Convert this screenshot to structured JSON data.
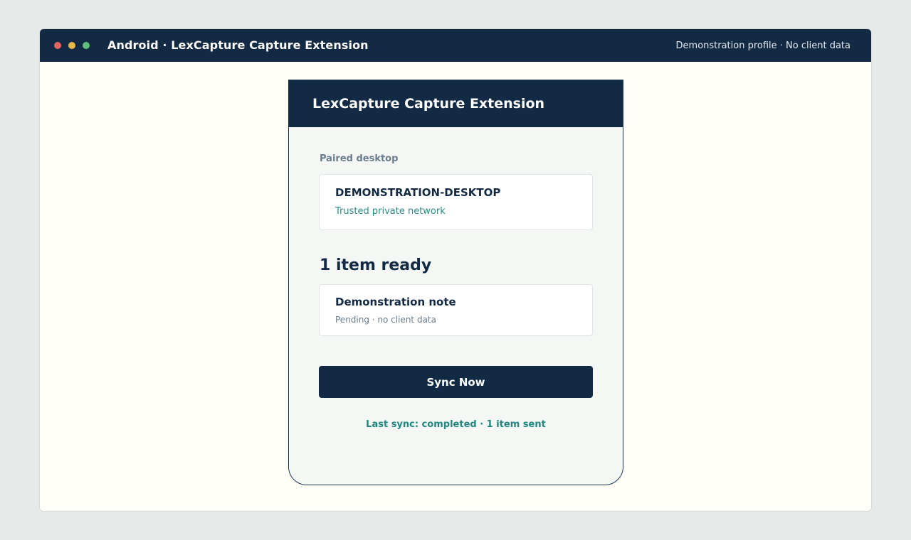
{
  "window": {
    "title": "Android · LexCapture Capture Extension",
    "status": "Demonstration profile · No client data",
    "controls": [
      "close-dot",
      "minimize-dot",
      "maximize-dot"
    ]
  },
  "app": {
    "title": "LexCapture Capture Extension",
    "paired": {
      "label": "Paired desktop",
      "device_name": "DEMONSTRATION-DESKTOP",
      "network": "Trusted private network"
    },
    "queue": {
      "heading": "1 item ready",
      "items": [
        {
          "title": "Demonstration note",
          "status": "Pending · no client data"
        }
      ]
    },
    "sync_button_label": "Sync Now",
    "last_sync": "Last sync: completed · 1 item sent"
  },
  "colors": {
    "navy": "#132a44",
    "teal": "#2b8a86",
    "window_bg": "#fefdf7",
    "page_bg": "#e6eae8",
    "dot_red": "#e2675f",
    "dot_yellow": "#e6b84c",
    "dot_green": "#5fbf7b"
  }
}
